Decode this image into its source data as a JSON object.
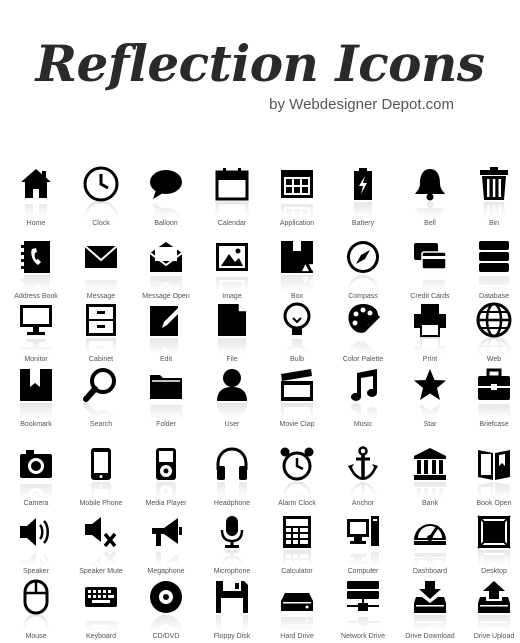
{
  "header": {
    "title": "Reflection Icons",
    "subtitle": "by Webdesigner Depot.com"
  },
  "icons": [
    {
      "label": "Home",
      "icon": "home-icon"
    },
    {
      "label": "Clock",
      "icon": "clock-icon"
    },
    {
      "label": "Balloon",
      "icon": "balloon-icon"
    },
    {
      "label": "Calendar",
      "icon": "calendar-icon"
    },
    {
      "label": "Application",
      "icon": "application-icon"
    },
    {
      "label": "Battery",
      "icon": "battery-icon"
    },
    {
      "label": "Bell",
      "icon": "bell-icon"
    },
    {
      "label": "Bin",
      "icon": "bin-icon"
    },
    {
      "label": "Address Book",
      "icon": "address-book-icon"
    },
    {
      "label": "Message",
      "icon": "message-icon"
    },
    {
      "label": "Message Open",
      "icon": "message-open-icon"
    },
    {
      "label": "Image",
      "icon": "image-icon"
    },
    {
      "label": "Box",
      "icon": "box-icon"
    },
    {
      "label": "Compass",
      "icon": "compass-icon"
    },
    {
      "label": "Credit Cards",
      "icon": "credit-cards-icon"
    },
    {
      "label": "Database",
      "icon": "database-icon"
    },
    {
      "label": "Monitor",
      "icon": "monitor-icon"
    },
    {
      "label": "Cabinet",
      "icon": "cabinet-icon"
    },
    {
      "label": "Edit",
      "icon": "edit-icon"
    },
    {
      "label": "File",
      "icon": "file-icon"
    },
    {
      "label": "Bulb",
      "icon": "bulb-icon"
    },
    {
      "label": "Color Palette",
      "icon": "color-palette-icon"
    },
    {
      "label": "Print",
      "icon": "print-icon"
    },
    {
      "label": "Web",
      "icon": "web-icon"
    },
    {
      "label": "Bookmark",
      "icon": "bookmark-icon"
    },
    {
      "label": "Search",
      "icon": "search-icon"
    },
    {
      "label": "Folder",
      "icon": "folder-icon"
    },
    {
      "label": "User",
      "icon": "user-icon"
    },
    {
      "label": "Movie Clap",
      "icon": "movie-clap-icon"
    },
    {
      "label": "Music",
      "icon": "music-icon"
    },
    {
      "label": "Star",
      "icon": "star-icon"
    },
    {
      "label": "Briefcase",
      "icon": "briefcase-icon"
    },
    {
      "label": "Camera",
      "icon": "camera-icon"
    },
    {
      "label": "Mobile Phone",
      "icon": "mobile-phone-icon"
    },
    {
      "label": "Media Player",
      "icon": "media-player-icon"
    },
    {
      "label": "Headphone",
      "icon": "headphone-icon"
    },
    {
      "label": "Alarm Clock",
      "icon": "alarm-clock-icon"
    },
    {
      "label": "Anchor",
      "icon": "anchor-icon"
    },
    {
      "label": "Bank",
      "icon": "bank-icon"
    },
    {
      "label": "Book Open",
      "icon": "book-open-icon"
    },
    {
      "label": "Speaker",
      "icon": "speaker-icon"
    },
    {
      "label": "Speaker Mute",
      "icon": "speaker-mute-icon"
    },
    {
      "label": "Megaphone",
      "icon": "megaphone-icon"
    },
    {
      "label": "Microphone",
      "icon": "microphone-icon"
    },
    {
      "label": "Calculator",
      "icon": "calculator-icon"
    },
    {
      "label": "Computer",
      "icon": "computer-icon"
    },
    {
      "label": "Dashboard",
      "icon": "dashboard-icon"
    },
    {
      "label": "Desktop",
      "icon": "desktop-icon"
    },
    {
      "label": "Mouse",
      "icon": "mouse-icon"
    },
    {
      "label": "Keyboard",
      "icon": "keyboard-icon"
    },
    {
      "label": "CD/DVD",
      "icon": "cd-dvd-icon"
    },
    {
      "label": "Floppy Disk",
      "icon": "floppy-disk-icon"
    },
    {
      "label": "Hard Drive",
      "icon": "hard-drive-icon"
    },
    {
      "label": "Network Drive",
      "icon": "network-drive-icon"
    },
    {
      "label": "Drive Download",
      "icon": "drive-download-icon"
    },
    {
      "label": "Drive Upload",
      "icon": "drive-upload-icon"
    }
  ],
  "colors": {
    "icon": "#000000",
    "label": "#555555",
    "title": "#2a2a2a",
    "background": "#ffffff"
  }
}
